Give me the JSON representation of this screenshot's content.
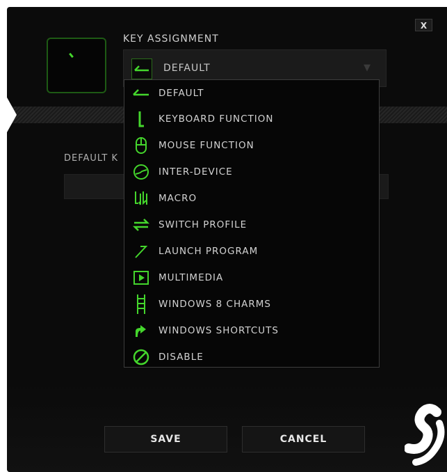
{
  "window": {
    "close_label": "X"
  },
  "key_assignment": {
    "title": "KEY ASSIGNMENT",
    "selected": "DEFAULT",
    "selected_icon": "default-arrow-icon",
    "caret_icon": "triangle-down-icon"
  },
  "default_key": {
    "label": "DEFAULT K"
  },
  "dropdown": {
    "items": [
      {
        "label": "DEFAULT",
        "icon": "default-arrow-icon"
      },
      {
        "label": "KEYBOARD FUNCTION",
        "icon": "keyboard-function-icon"
      },
      {
        "label": "MOUSE FUNCTION",
        "icon": "mouse-icon"
      },
      {
        "label": "INTER-DEVICE",
        "icon": "inter-device-icon"
      },
      {
        "label": "MACRO",
        "icon": "macro-icon"
      },
      {
        "label": "SWITCH PROFILE",
        "icon": "switch-profile-icon"
      },
      {
        "label": "LAUNCH PROGRAM",
        "icon": "launch-program-icon"
      },
      {
        "label": "MULTIMEDIA",
        "icon": "multimedia-icon"
      },
      {
        "label": "WINDOWS 8 CHARMS",
        "icon": "windows-charms-icon"
      },
      {
        "label": "WINDOWS SHORTCUTS",
        "icon": "windows-shortcuts-icon"
      },
      {
        "label": "DISABLE",
        "icon": "disable-icon"
      }
    ]
  },
  "footer": {
    "save_label": "SAVE",
    "cancel_label": "CANCEL"
  },
  "colors": {
    "accent": "#44d62c",
    "background": "#0b0b0b",
    "text": "#d2d2d2"
  }
}
